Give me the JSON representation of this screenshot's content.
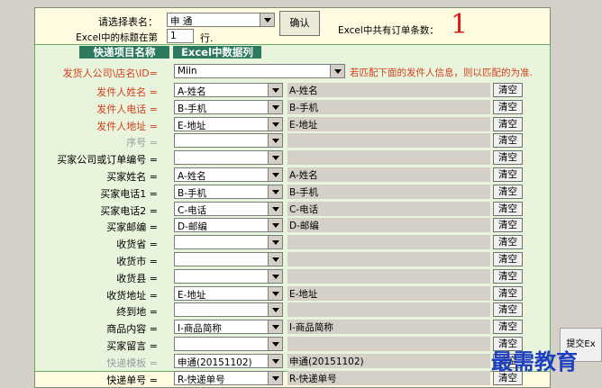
{
  "top": {
    "select_table_label": "请选择表名：",
    "table_value": "申  通",
    "title_row_label": "Excel中的标题在第",
    "title_row_value": "1",
    "title_row_suffix": "行.",
    "confirm_label": "确认",
    "order_count_label": "Excel中共有订单条数：",
    "order_count_value": "1"
  },
  "headers": {
    "left": "快递项目名称",
    "right": "Excel中数据列"
  },
  "sender_company": {
    "label": "发货人公司\\店名\\ID=",
    "value": "Miin",
    "hint": "若匹配下面的发件人信息，则以匹配的为准."
  },
  "clear_label": "清空",
  "rows": [
    {
      "label": "发件人姓名 =",
      "color": "red",
      "value": "A-姓名",
      "display": "A-姓名"
    },
    {
      "label": "发件人电话 =",
      "color": "red",
      "value": "B-手机",
      "display": "B-手机"
    },
    {
      "label": "发件人地址 =",
      "color": "red",
      "value": "E-地址",
      "display": "E-地址"
    },
    {
      "label": "序号 =",
      "color": "gray",
      "value": "",
      "display": ""
    },
    {
      "label": "买家公司或订单编号 =",
      "color": "blk",
      "value": "",
      "display": ""
    },
    {
      "label": "买家姓名 =",
      "color": "blk",
      "value": "A-姓名",
      "display": "A-姓名"
    },
    {
      "label": "买家电话1 =",
      "color": "blk",
      "value": "B-手机",
      "display": "B-手机"
    },
    {
      "label": "买家电话2 =",
      "color": "blk",
      "value": "C-电话",
      "display": "C-电话"
    },
    {
      "label": "买家邮编 =",
      "color": "blk",
      "value": "D-邮编",
      "display": "D-邮编"
    },
    {
      "label": "收货省 =",
      "color": "blk",
      "value": "",
      "display": ""
    },
    {
      "label": "收货市 =",
      "color": "blk",
      "value": "",
      "display": ""
    },
    {
      "label": "收货县 =",
      "color": "blk",
      "value": "",
      "display": ""
    },
    {
      "label": "收货地址 =",
      "color": "blk",
      "value": "E-地址",
      "display": "E-地址"
    },
    {
      "label": "终到地 =",
      "color": "blk",
      "value": "",
      "display": ""
    },
    {
      "label": "商品内容 =",
      "color": "blk",
      "value": "I-商品简称",
      "display": "I-商品简称"
    },
    {
      "label": "买家留言 =",
      "color": "blk",
      "value": "",
      "display": ""
    },
    {
      "label": "快递模板 =",
      "color": "gray",
      "value": "申通(20151102)",
      "display": "申通(20151102)"
    },
    {
      "label": "快递单号 =",
      "color": "blk",
      "value": "R-快递单号",
      "display": "R-快递单号"
    }
  ],
  "side_button_label": "提交Ex",
  "watermark": "最需教育",
  "colors": {
    "panel_bg": "#fffbe1",
    "header_bg": "#2e7a5e",
    "red_label": "#d2401d",
    "order_count": "#e01818"
  }
}
